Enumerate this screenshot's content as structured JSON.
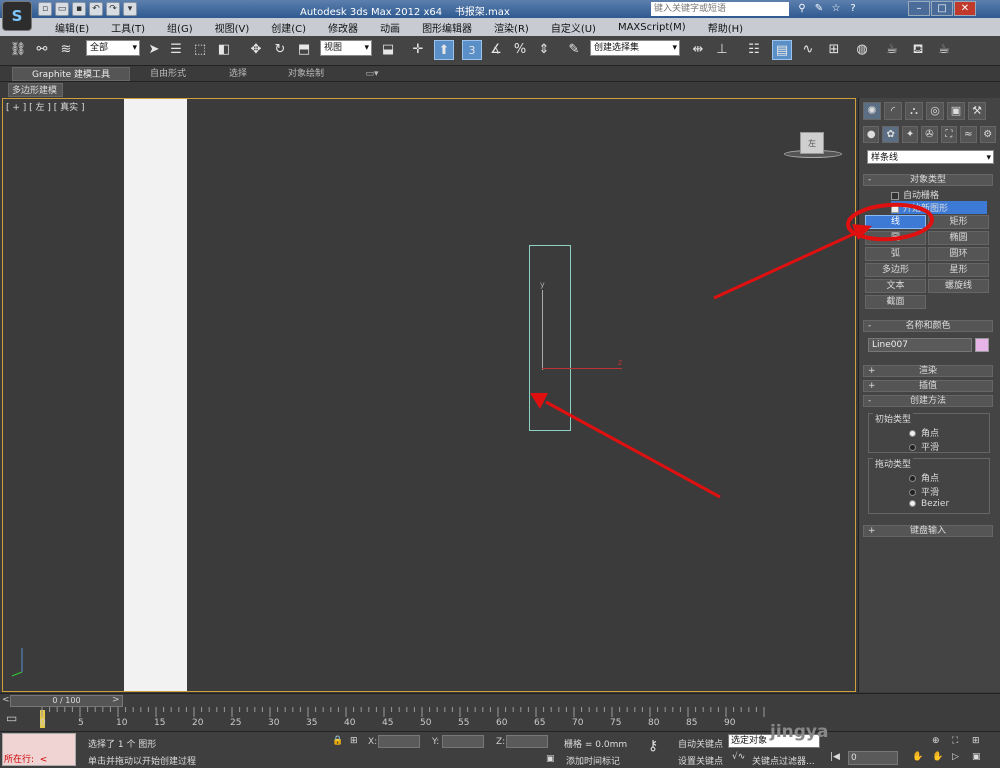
{
  "app": {
    "logo_letter": "S",
    "title": "Autodesk 3ds Max  2012 x64",
    "filename": "书报架.max",
    "search_placeholder": "键入关键字或短语"
  },
  "menu": [
    "编辑(E)",
    "工具(T)",
    "组(G)",
    "视图(V)",
    "创建(C)",
    "修改器",
    "动画",
    "图形编辑器",
    "渲染(R)",
    "自定义(U)",
    "MAXScript(M)",
    "帮助(H)"
  ],
  "toolbar": {
    "selection_filter": "全部",
    "reference_coord": "视图",
    "named_selection": "创建选择集",
    "snap_label": "3"
  },
  "ribbon": {
    "tabs": [
      "Graphite 建模工具",
      "自由形式",
      "选择",
      "对象绘制"
    ],
    "subtab": "多边形建模"
  },
  "viewport": {
    "label": "[ + ] [ 左 ] [ 真实 ]",
    "viewcube_face": "左",
    "gizmo_y": "y",
    "gizmo_x": "z"
  },
  "command_panel": {
    "category": "样条线",
    "object_type": {
      "title": "对象类型",
      "autogrid": "自动栅格",
      "start_new_shape": "开始新图形",
      "buttons": [
        "线",
        "矩形",
        "圆",
        "椭圆",
        "弧",
        "圆环",
        "多边形",
        "星形",
        "文本",
        "螺旋线",
        "截面"
      ],
      "selected": "线"
    },
    "name_color": {
      "title": "名称和颜色",
      "name": "Line007",
      "color": "#e7b4e7"
    },
    "rollouts": {
      "render": "渲染",
      "interpolation": "插值",
      "creation_method": "创建方法",
      "keyboard_entry": "键盘输入"
    },
    "initial_type": {
      "title": "初始类型",
      "options": [
        "角点",
        "平滑"
      ],
      "selected": "角点"
    },
    "drag_type": {
      "title": "拖动类型",
      "options": [
        "角点",
        "平滑",
        "Bezier"
      ],
      "selected": "Bezier"
    }
  },
  "timeline": {
    "frame_display": "0 / 100",
    "ticks": [
      "0",
      "5",
      "10",
      "15",
      "20",
      "25",
      "30",
      "35",
      "40",
      "45",
      "50",
      "55",
      "60",
      "65",
      "70",
      "75",
      "80",
      "85",
      "90"
    ]
  },
  "status": {
    "running_label": "所在行:",
    "selection_info": "选择了 1 个 图形",
    "prompt": "单击并拖动以开始创建过程",
    "x_label": "X:",
    "y_label": "Y:",
    "z_label": "Z:",
    "grid": "栅格 = 0.0mm",
    "add_time_tag": "添加时间标记",
    "autokey": "自动关键点",
    "selected_obj": "选定对象",
    "set_key": "设置关键点",
    "key_filters": "关键点过滤器...",
    "frame_value": "0",
    "watermark": "jingya"
  },
  "annotation_color": "#e01010"
}
